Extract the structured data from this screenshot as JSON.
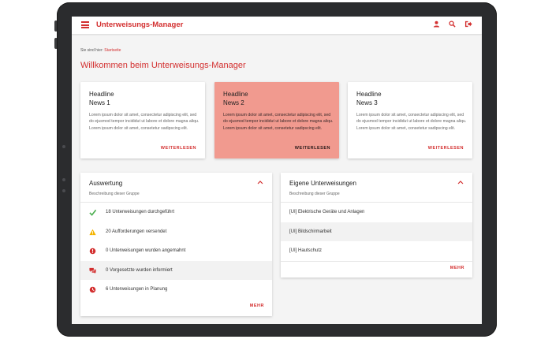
{
  "app": {
    "title": "Unterweisungs-Manager"
  },
  "breadcrumb": {
    "prefix": "Sie sind hier:",
    "current": "Startseite"
  },
  "page": {
    "title": "Willkommen beim Unterweisungs-Manager"
  },
  "colors": {
    "accent": "#d32f2f",
    "news_active_bg": "#f19a8f",
    "success": "#4caf50",
    "warning": "#f4b400"
  },
  "news": [
    {
      "headline": "Headline",
      "subline": "News 1",
      "text": "Lorem ipsum dolor sit amet, consectetur adipiscing elit, sed do ejusmod tempor incididut ut labore et dolore magna aliqu. Lorem ipsum dolor sit amet, consetetur sadipscing elit.",
      "more": "WEITERLESEN",
      "active": false
    },
    {
      "headline": "Headline",
      "subline": "News 2",
      "text": "Lorem ipsum dolor sit amet, consectetur adipiscing elit, sed do ejusmod tempor incididut ut labore et dolore magna aliqu. Lorem ipsum dolor sit amet, consetetur sadipscing elit.",
      "more": "WEITERLESEN",
      "active": true
    },
    {
      "headline": "Headline",
      "subline": "News 3",
      "text": "Lorem ipsum dolor sit amet, consectetur adipiscing elit, sed do ejusmod tempor incididut ut labore et dolore magna aliqu. Lorem ipsum dolor sit amet, consetetur sadipscing elit.",
      "more": "WEITERLESEN",
      "active": false
    }
  ],
  "auswertung": {
    "title": "Auswertung",
    "subtitle": "Beschreibung dieser Gruppe",
    "items": [
      {
        "icon": "check-icon",
        "text": "18 Unterweisungen durchgeführt"
      },
      {
        "icon": "warning-icon",
        "text": "20 Aufforderungen versendet"
      },
      {
        "icon": "alert-circle-icon",
        "text": "0 Unterweisungen wurden angemahnt"
      },
      {
        "icon": "chat-icon",
        "text": "0 Vorgesetzte wurden informiert"
      },
      {
        "icon": "clock-icon",
        "text": "6 Unterweisungen in Planung"
      }
    ],
    "more": "MEHR"
  },
  "eigene": {
    "title": "Eigene Unterweisungen",
    "subtitle": "Beschreibung dieser Gruppe",
    "items": [
      {
        "text": "[UI] Elektrische Geräte und Anlagen"
      },
      {
        "text": "[UI] Bildschirmarbeit"
      },
      {
        "text": "[UI] Hautschutz"
      }
    ],
    "more": "MEHR"
  }
}
